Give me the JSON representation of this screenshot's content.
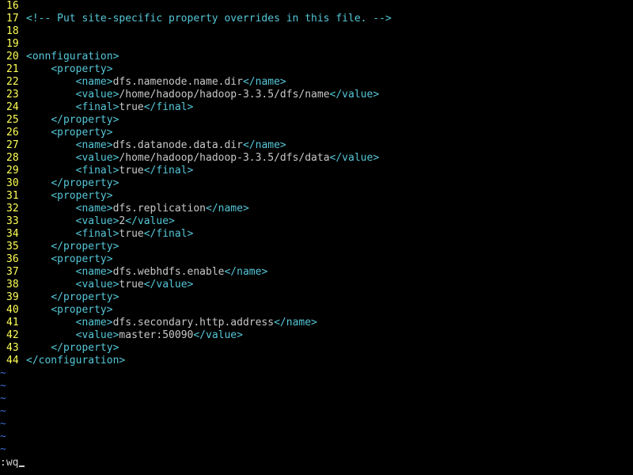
{
  "editor": {
    "colors": {
      "background": "#000000",
      "line_number": "#ffff55",
      "tag": "#55c7d8",
      "text": "#c8c8c8",
      "tilde": "#3d6fd6"
    },
    "lines": [
      {
        "num": "16",
        "indent": "",
        "comment": ""
      },
      {
        "num": "17",
        "indent": "",
        "comment": "<!-- Put site-specific property overrides in this file. -->"
      },
      {
        "num": "18",
        "indent": ""
      },
      {
        "num": "19",
        "indent": ""
      },
      {
        "num": "20",
        "indent": "",
        "open": "<onnfiguration>"
      },
      {
        "num": "21",
        "indent": "    ",
        "open": "<property>"
      },
      {
        "num": "22",
        "indent": "        ",
        "open": "<name>",
        "text": "dfs.namenode.name.dir",
        "close": "</name>"
      },
      {
        "num": "23",
        "indent": "        ",
        "open": "<value>",
        "text": "/home/hadoop/hadoop-3.3.5/dfs/name",
        "close": "</value>"
      },
      {
        "num": "24",
        "indent": "        ",
        "open": "<final>",
        "text": "true",
        "close": "</final>"
      },
      {
        "num": "25",
        "indent": "    ",
        "open": "</property>"
      },
      {
        "num": "26",
        "indent": "    ",
        "open": "<property>"
      },
      {
        "num": "27",
        "indent": "        ",
        "open": "<name>",
        "text": "dfs.datanode.data.dir",
        "close": "</name>"
      },
      {
        "num": "28",
        "indent": "        ",
        "open": "<value>",
        "text": "/home/hadoop/hadoop-3.3.5/dfs/data",
        "close": "</value>"
      },
      {
        "num": "29",
        "indent": "        ",
        "open": "<final>",
        "text": "true",
        "close": "</final>"
      },
      {
        "num": "30",
        "indent": "    ",
        "open": "</property>"
      },
      {
        "num": "31",
        "indent": "    ",
        "open": "<property>"
      },
      {
        "num": "32",
        "indent": "        ",
        "open": "<name>",
        "text": "dfs.replication",
        "close": "</name>"
      },
      {
        "num": "33",
        "indent": "        ",
        "open": "<value>",
        "text": "2",
        "close": "</value>"
      },
      {
        "num": "34",
        "indent": "        ",
        "open": "<final>",
        "text": "true",
        "close": "</final>"
      },
      {
        "num": "35",
        "indent": "    ",
        "open": "</property>"
      },
      {
        "num": "36",
        "indent": "    ",
        "open": "<property>"
      },
      {
        "num": "37",
        "indent": "        ",
        "open": "<name>",
        "text": "dfs.webhdfs.enable",
        "close": "</name>"
      },
      {
        "num": "38",
        "indent": "        ",
        "open": "<value>",
        "text": "true",
        "close": "</value>"
      },
      {
        "num": "39",
        "indent": "    ",
        "open": "</property>"
      },
      {
        "num": "40",
        "indent": "    ",
        "open": "<property>"
      },
      {
        "num": "41",
        "indent": "        ",
        "open": "<name>",
        "text": "dfs.secondary.http.address",
        "close": "</name>"
      },
      {
        "num": "42",
        "indent": "        ",
        "open": "<value>",
        "text": "master:50090",
        "close": "</value>"
      },
      {
        "num": "43",
        "indent": "    ",
        "open": "</property>"
      },
      {
        "num": "44",
        "indent": "",
        "open": "</configuration>"
      }
    ],
    "tildes": [
      "~",
      "~",
      "~",
      "~",
      "~",
      "~",
      "~"
    ],
    "command_line": ":wq"
  }
}
